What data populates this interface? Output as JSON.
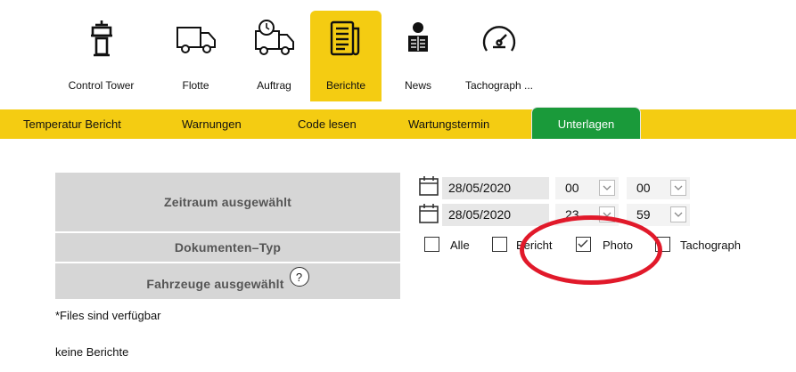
{
  "nav": {
    "items": [
      {
        "label": "Control Tower",
        "icon": "control-tower-icon"
      },
      {
        "label": "Flotte",
        "icon": "truck-icon"
      },
      {
        "label": "Auftrag",
        "icon": "truck-clock-icon"
      },
      {
        "label": "Berichte",
        "icon": "report-icon",
        "active": true
      },
      {
        "label": "News",
        "icon": "news-reader-icon"
      },
      {
        "label": "Tachograph ...",
        "icon": "speedometer-icon"
      }
    ]
  },
  "subnav": {
    "tabs": [
      {
        "label": "Temperatur Bericht"
      },
      {
        "label": "Warnungen"
      },
      {
        "label": "Code lesen"
      },
      {
        "label": "Wartungstermin"
      },
      {
        "label": "Unterlagen",
        "active": true
      }
    ]
  },
  "panel": {
    "period_label": "Zeitraum ausgewählt",
    "doctype_label": "Dokumenten–Typ",
    "vehicles_label": "Fahrzeuge ausgewählt",
    "help_symbol": "?",
    "files_note": "*Files sind verfügbar",
    "no_reports": "keine Berichte"
  },
  "dates": {
    "from": {
      "date": "28/05/2020",
      "hour": "00",
      "minute": "00"
    },
    "to": {
      "date": "28/05/2020",
      "hour": "23",
      "minute": "59"
    }
  },
  "filters": {
    "all": {
      "label": "Alle",
      "checked": false
    },
    "report": {
      "label": "Bericht",
      "checked": false
    },
    "photo": {
      "label": "Photo",
      "checked": true
    },
    "tachograph": {
      "label": "Tachograph",
      "checked": false
    }
  },
  "colors": {
    "accent_yellow": "#f4cc12",
    "active_green": "#1a9a3a",
    "highlight_red": "#e1192a"
  }
}
